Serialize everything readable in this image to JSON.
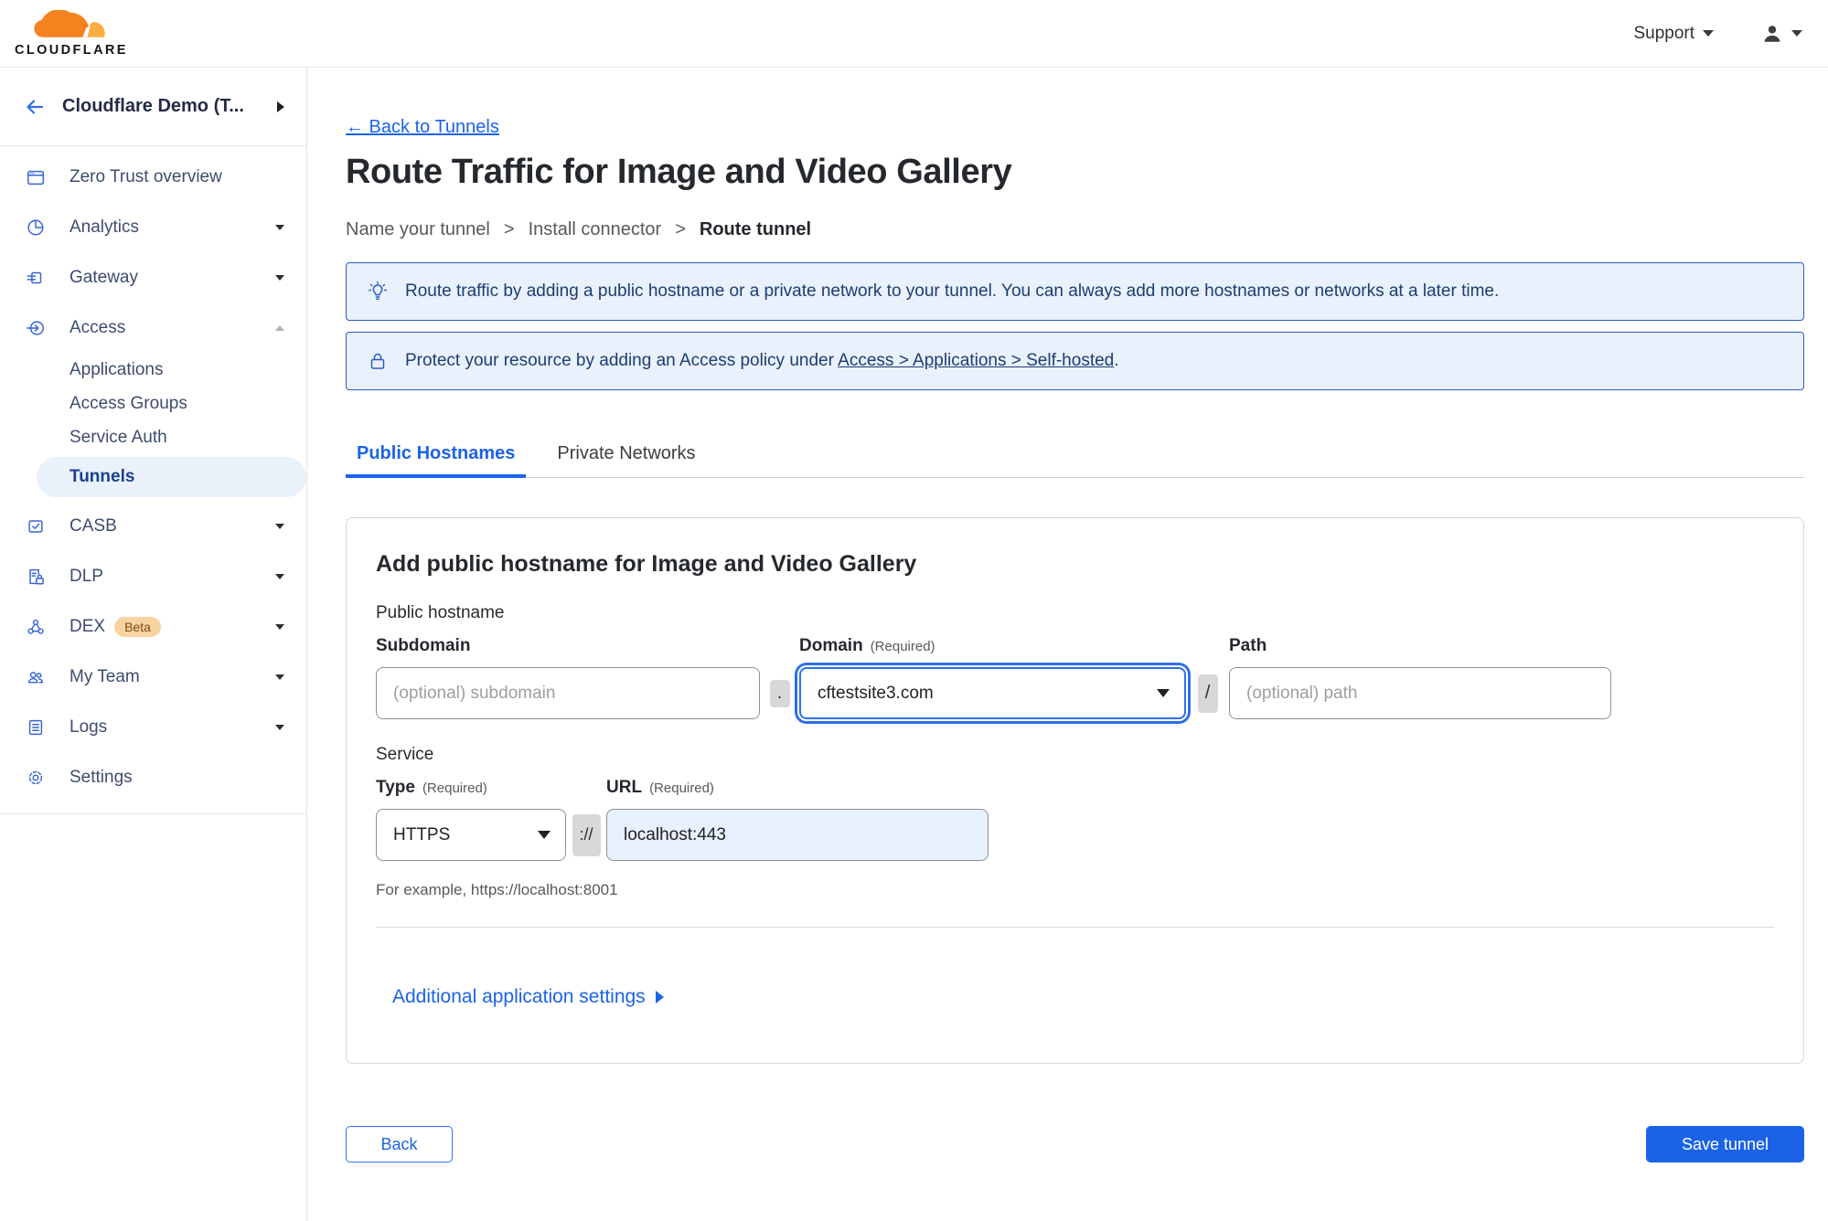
{
  "topbar": {
    "logo_text": "CLOUDFLARE",
    "support_label": "Support"
  },
  "sidebar": {
    "account_name": "Cloudflare Demo (T...",
    "items": [
      {
        "label": "Zero Trust overview"
      },
      {
        "label": "Analytics"
      },
      {
        "label": "Gateway"
      },
      {
        "label": "Access",
        "children": [
          "Applications",
          "Access Groups",
          "Service Auth",
          "Tunnels"
        ],
        "active_child": "Tunnels"
      },
      {
        "label": "CASB"
      },
      {
        "label": "DLP"
      },
      {
        "label": "DEX",
        "badge": "Beta"
      },
      {
        "label": "My Team"
      },
      {
        "label": "Logs"
      },
      {
        "label": "Settings"
      }
    ]
  },
  "page": {
    "back_link": "← Back to Tunnels",
    "title": "Route Traffic for Image and Video Gallery",
    "breadcrumb": [
      "Name your tunnel",
      "Install connector",
      "Route tunnel"
    ],
    "breadcrumb_separator": ">",
    "banners": [
      {
        "icon": "lightbulb-icon",
        "text": "Route traffic by adding a public hostname or a private network to your tunnel. You can always add more hostnames or networks at a later time."
      },
      {
        "icon": "lock-icon",
        "text_prefix": "Protect your resource by adding an Access policy under",
        "link_label": "Access > Applications > Self-hosted",
        "text_suffix": "."
      }
    ],
    "tabs": [
      {
        "label": "Public Hostnames",
        "active": true
      },
      {
        "label": "Private Networks",
        "active": false
      }
    ],
    "form": {
      "heading": "Add public hostname for Image and Video Gallery",
      "section_public_hostname": "Public hostname",
      "subdomain": {
        "label": "Subdomain",
        "placeholder": "(optional) subdomain"
      },
      "domain": {
        "label": "Domain",
        "required": "(Required)",
        "value": "cftestsite3.com"
      },
      "path": {
        "label": "Path",
        "placeholder": "(optional) path"
      },
      "sep_dot": ".",
      "sep_slash": "/",
      "sep_scheme": "://",
      "section_service": "Service",
      "type": {
        "label": "Type",
        "required": "(Required)",
        "value": "HTTPS"
      },
      "url": {
        "label": "URL",
        "required": "(Required)",
        "value": "localhost:443"
      },
      "example": "For example, https://localhost:8001",
      "additional_settings": "Additional application settings"
    },
    "buttons": {
      "back": "Back",
      "save": "Save tunnel"
    }
  },
  "colors": {
    "accent": "#1b63e6",
    "banner_bg": "#e8f1fc",
    "banner_border": "#2c5dc2",
    "active_pill_bg": "#e9f1fb",
    "brand_orange": "#f6821f",
    "brand_orange_light": "#fbad41"
  }
}
